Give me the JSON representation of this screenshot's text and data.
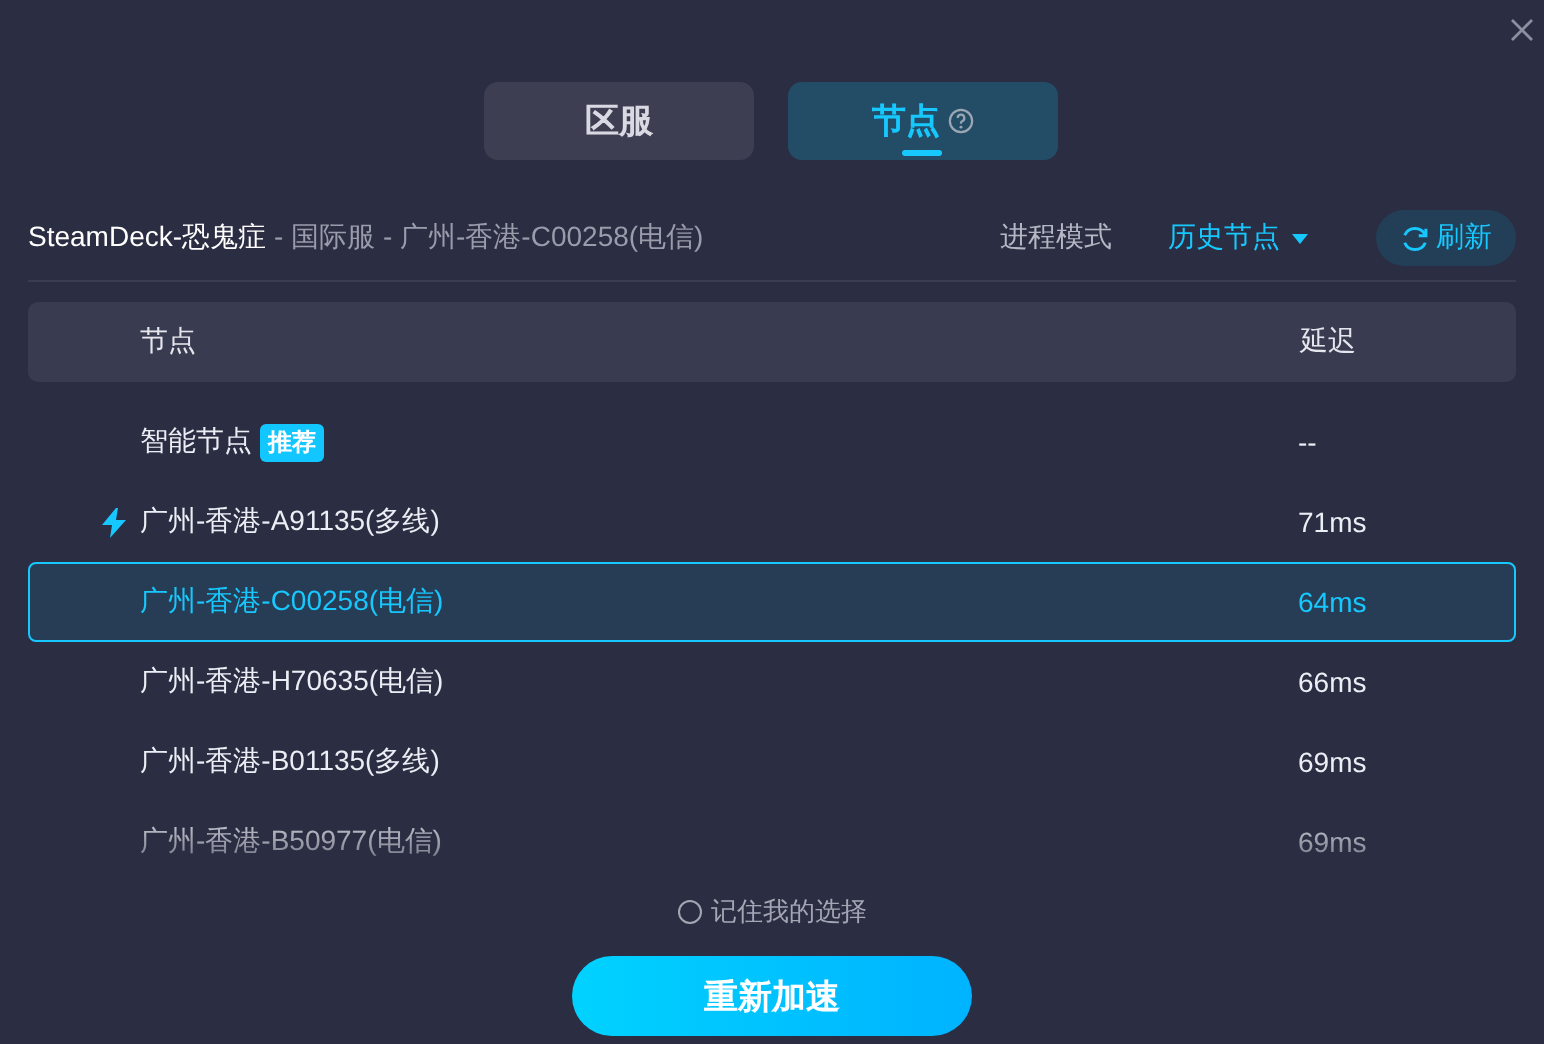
{
  "tabs": [
    {
      "label": "区服",
      "selected": false,
      "help": false
    },
    {
      "label": "节点",
      "selected": true,
      "help": true
    }
  ],
  "info": {
    "game": "SteamDeck-恐鬼症",
    "path": " - 国际服 - 广州-香港-C00258(电信)"
  },
  "actions": {
    "mode": "进程模式",
    "history": "历史节点",
    "refresh": "刷新"
  },
  "table": {
    "columns": [
      "节点",
      "延迟"
    ],
    "rows": [
      {
        "name": "智能节点",
        "badge": "推荐",
        "latency": "--",
        "fastest": false,
        "selected": false
      },
      {
        "name": "广州-香港-A91135(多线)",
        "latency": "71ms",
        "fastest": true,
        "selected": false
      },
      {
        "name": "广州-香港-C00258(电信)",
        "latency": "64ms",
        "fastest": false,
        "selected": true
      },
      {
        "name": "广州-香港-H70635(电信)",
        "latency": "66ms",
        "fastest": false,
        "selected": false
      },
      {
        "name": "广州-香港-B01135(多线)",
        "latency": "69ms",
        "fastest": false,
        "selected": false
      },
      {
        "name": "广州-香港-B50977(电信)",
        "latency": "69ms",
        "fastest": false,
        "selected": false
      }
    ]
  },
  "remember": {
    "label": "记住我的选择",
    "checked": false
  },
  "primary_button": "重新加速"
}
